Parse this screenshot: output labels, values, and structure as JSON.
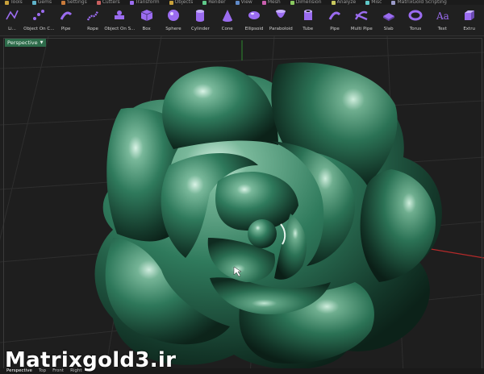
{
  "menu": {
    "tabs": [
      "Tools",
      "Gems",
      "Settings",
      "Cutters",
      "Transform",
      "Objects",
      "Render",
      "View",
      "Mesh",
      "Dimension",
      "Analyze",
      "Misc",
      "MatrixGold Scripting"
    ]
  },
  "toolbar": {
    "tools": [
      {
        "label": "Li...",
        "icon": "polyline-icon",
        "color": "#9b6cf0"
      },
      {
        "label": "Object On C...",
        "icon": "object-on-curve-icon",
        "color": "#9b6cf0"
      },
      {
        "label": "Pipe",
        "icon": "pipe-icon",
        "color": "#9b6cf0"
      },
      {
        "label": "Rope",
        "icon": "rope-icon",
        "color": "#9b6cf0"
      },
      {
        "label": "Object On S...",
        "icon": "object-on-surface-icon",
        "color": "#9b6cf0"
      },
      {
        "label": "Box",
        "icon": "box-icon",
        "color": "#9b6cf0"
      },
      {
        "label": "Sphere",
        "icon": "sphere-icon",
        "color": "#9b6cf0"
      },
      {
        "label": "Cylinder",
        "icon": "cylinder-icon",
        "color": "#9b6cf0"
      },
      {
        "label": "Cone",
        "icon": "cone-icon",
        "color": "#9b6cf0"
      },
      {
        "label": "Ellipsoid",
        "icon": "ellipsoid-icon",
        "color": "#9b6cf0"
      },
      {
        "label": "Paraboloid",
        "icon": "paraboloid-icon",
        "color": "#9b6cf0"
      },
      {
        "label": "Tube",
        "icon": "tube-icon",
        "color": "#9b6cf0"
      },
      {
        "label": "Pipe",
        "icon": "pipe-icon",
        "color": "#9b6cf0"
      },
      {
        "label": "Multi Pipe",
        "icon": "multi-pipe-icon",
        "color": "#9b6cf0"
      },
      {
        "label": "Slab",
        "icon": "slab-icon",
        "color": "#9b6cf0"
      },
      {
        "label": "Torus",
        "icon": "torus-icon",
        "color": "#9b6cf0"
      },
      {
        "label": "Text",
        "icon": "text-icon",
        "color": "#9b6cf0"
      },
      {
        "label": "Extru",
        "icon": "extrude-icon",
        "color": "#9b6cf0"
      }
    ]
  },
  "viewport": {
    "label": "Perspective",
    "model": "3D flower (rose) with green glossy petals",
    "model_color": "#2f7a5c"
  },
  "view_tabs": [
    "Perspective",
    "Top",
    "Front",
    "Right"
  ],
  "add_tab": "+",
  "watermark": "Matrixgold3.ir",
  "axis": {
    "x_color": "#c03030",
    "y_color": "#30a030"
  }
}
